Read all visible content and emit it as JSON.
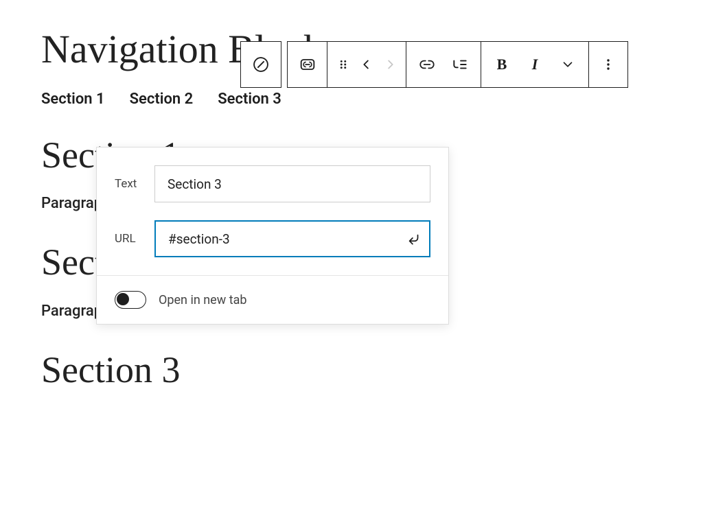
{
  "title": "Navigation Block",
  "nav": {
    "items": [
      {
        "label": "Section 1"
      },
      {
        "label": "Section 2"
      },
      {
        "label": "Section 3"
      }
    ]
  },
  "sections": [
    {
      "heading": "Section 1",
      "paragraph": "Paragraph"
    },
    {
      "heading": "Section 2",
      "paragraph": "Paragraph"
    },
    {
      "heading": "Section 3"
    }
  ],
  "toolbar": {
    "block_icon": "navigation-link",
    "parent_icon": "link-block",
    "drag_icon": "drag",
    "prev_enabled": true,
    "next_enabled": false,
    "link_icon": "link",
    "submenu_icon": "submenu",
    "bold_label": "B",
    "italic_label": "I",
    "more_icon": "chevron-down",
    "options_icon": "more-vertical"
  },
  "popover": {
    "text_label": "Text",
    "text_value": "Section 3",
    "url_label": "URL",
    "url_value": "#section-3",
    "submit_icon": "enter",
    "new_tab_label": "Open in new tab",
    "new_tab_on": false
  }
}
